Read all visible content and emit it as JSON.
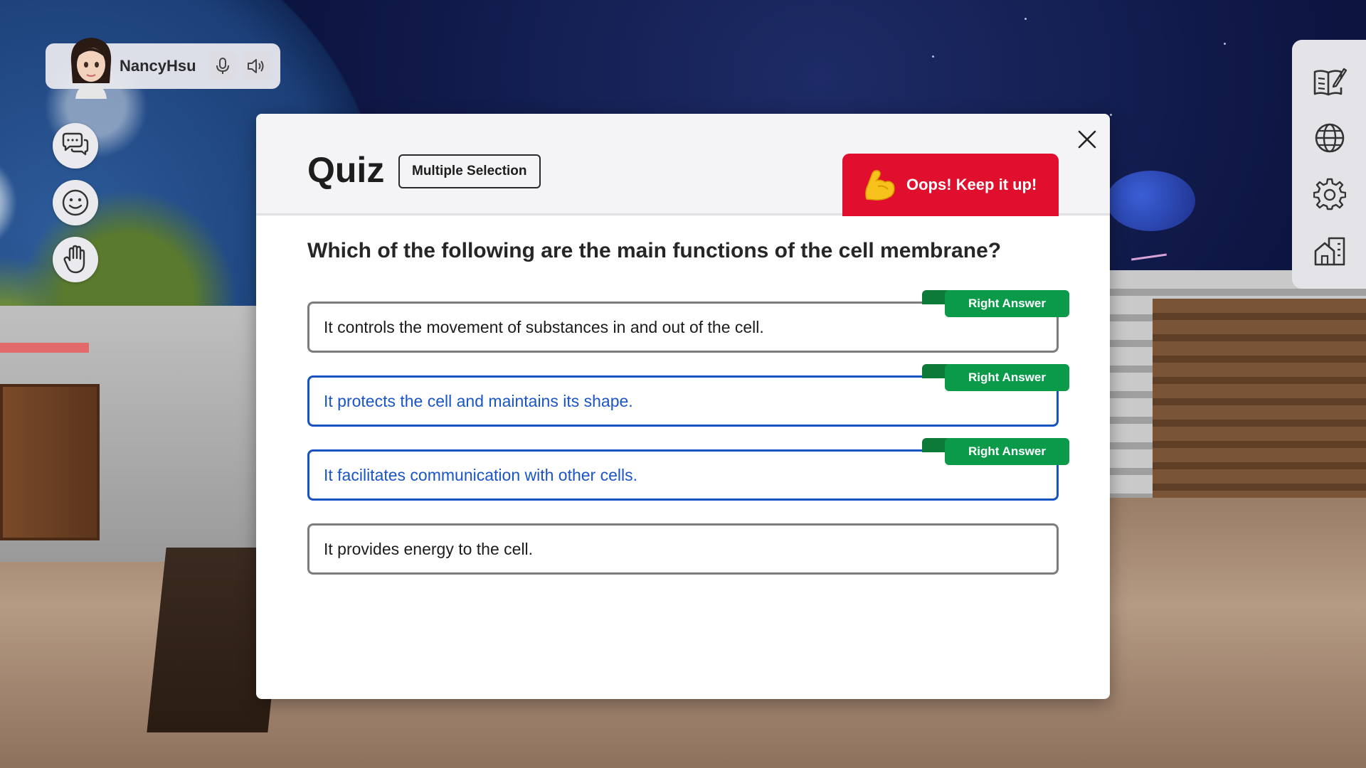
{
  "user": {
    "name": "NancyHsu",
    "mic_icon": "microphone-icon",
    "speaker_icon": "speaker-icon"
  },
  "left_toolbar": [
    {
      "icon": "chat-icon"
    },
    {
      "icon": "emoji-icon"
    },
    {
      "icon": "raise-hand-icon"
    }
  ],
  "right_toolbar": [
    {
      "icon": "notebook-edit-icon"
    },
    {
      "icon": "globe-icon"
    },
    {
      "icon": "settings-gear-icon"
    },
    {
      "icon": "building-icon"
    }
  ],
  "quiz": {
    "title": "Quiz",
    "type_label": "Multiple Selection",
    "result_text": "Oops! Keep it up!",
    "result_icon": "flexed-biceps-icon",
    "question": "Which of the following are the main functions of the cell membrane?",
    "options": [
      {
        "text": "It controls the movement of substances in and out of the cell.",
        "tag": "Right Answer",
        "selected": false
      },
      {
        "text": "It protects the cell and maintains its shape.",
        "tag": "Right Answer",
        "selected": true
      },
      {
        "text": "It facilitates communication with other cells.",
        "tag": "Right Answer",
        "selected": true
      },
      {
        "text": "It provides energy to the cell.",
        "tag": "",
        "selected": false
      }
    ]
  },
  "colors": {
    "accent_blue": "#1552c4",
    "right_answer_green": "#0a9a4a",
    "result_red": "#e10f2e"
  }
}
